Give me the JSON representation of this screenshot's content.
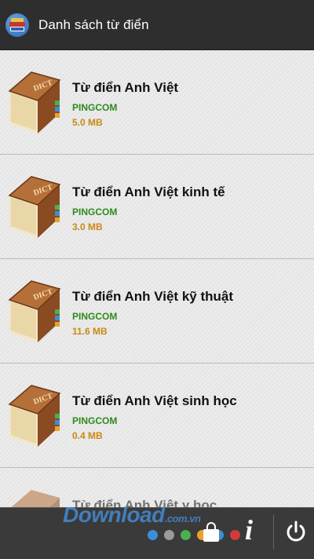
{
  "header": {
    "title": "Danh sách từ điển",
    "app_icon": "books-icon"
  },
  "dictionaries": [
    {
      "name": "Từ điển Anh Việt",
      "publisher": "PINGCOM",
      "size": "5.0 MB"
    },
    {
      "name": "Từ điển Anh Việt kinh tế",
      "publisher": "PINGCOM",
      "size": "3.0 MB"
    },
    {
      "name": "Từ điển Anh Việt kỹ thuật",
      "publisher": "PINGCOM",
      "size": "11.6 MB"
    },
    {
      "name": "Từ điển Anh Việt sinh học",
      "publisher": "PINGCOM",
      "size": "0.4 MB"
    },
    {
      "name": "Từ điển Anh Việt y học",
      "publisher": "",
      "size": ""
    }
  ],
  "book_icon_text": "DICT",
  "bottom_bar": {
    "watermark": "Download",
    "watermark_suffix": ".com.vn",
    "dot_colors": [
      "#3b8fd6",
      "#9a9a9a",
      "#4caf50",
      "#e8a22a",
      "#3b8fd6",
      "#d23a3a"
    ],
    "icons": [
      "shopping-bag-icon",
      "info-icon",
      "power-icon"
    ]
  },
  "colors": {
    "publisher": "#2f8a1c",
    "size": "#c88a12",
    "titlebar": "#2e2e2e"
  }
}
